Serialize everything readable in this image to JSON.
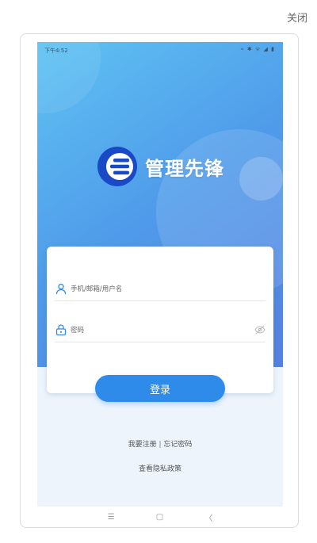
{
  "dialog": {
    "close_label": "关闭"
  },
  "status_bar": {
    "time": "下午4:52",
    "icons": "⌁ ✱ ᯤ ◢ ▮"
  },
  "app": {
    "name": "管理先锋",
    "brand_color": "#2e8bea"
  },
  "form": {
    "username_placeholder": "手机/邮箱/用户名",
    "password_placeholder": "密码",
    "login_label": "登录"
  },
  "links": {
    "register": "我要注册",
    "separator": "|",
    "forgot": "忘记密码",
    "privacy": "查看隐私政策"
  },
  "nav_bar": {
    "menu": "☰",
    "home": "▢",
    "back": "〈"
  }
}
